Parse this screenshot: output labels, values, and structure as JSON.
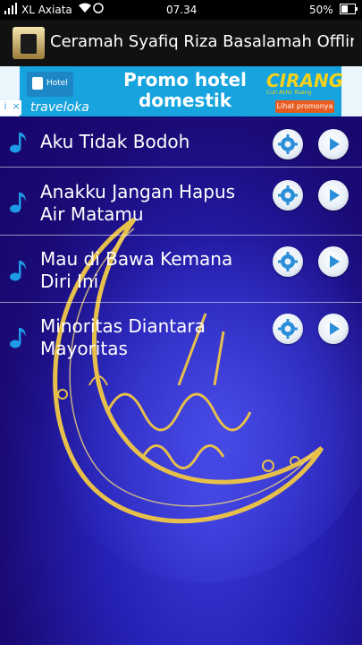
{
  "status_bar": {
    "carrier": "XL Axiata",
    "time": "07.34",
    "battery": "50%"
  },
  "app": {
    "title": "Ceramah Syafiq Riza Basalamah Offline"
  },
  "ad": {
    "hotel_label": "Hotel",
    "brand": "traveloka",
    "promo_line1": "Promo hotel",
    "promo_line2": "domestik",
    "cirang_brand": "CIRANG",
    "cirang_tagline": "Cuti Akhir Ruang",
    "cta": "Lihat promonya",
    "info_icon": "info-icon",
    "close_icon": "close-icon"
  },
  "colors": {
    "accent": "#1e9be6",
    "background": "#2520b4",
    "moon_gold": "#e6c04b"
  },
  "tracks": [
    {
      "title": "Aku Tidak Bodoh"
    },
    {
      "title": "Anakku Jangan Hapus Air Matamu"
    },
    {
      "title": "Mau di Bawa Kemana Diri Ini"
    },
    {
      "title": "Minoritas Diantara Mayoritas"
    }
  ]
}
